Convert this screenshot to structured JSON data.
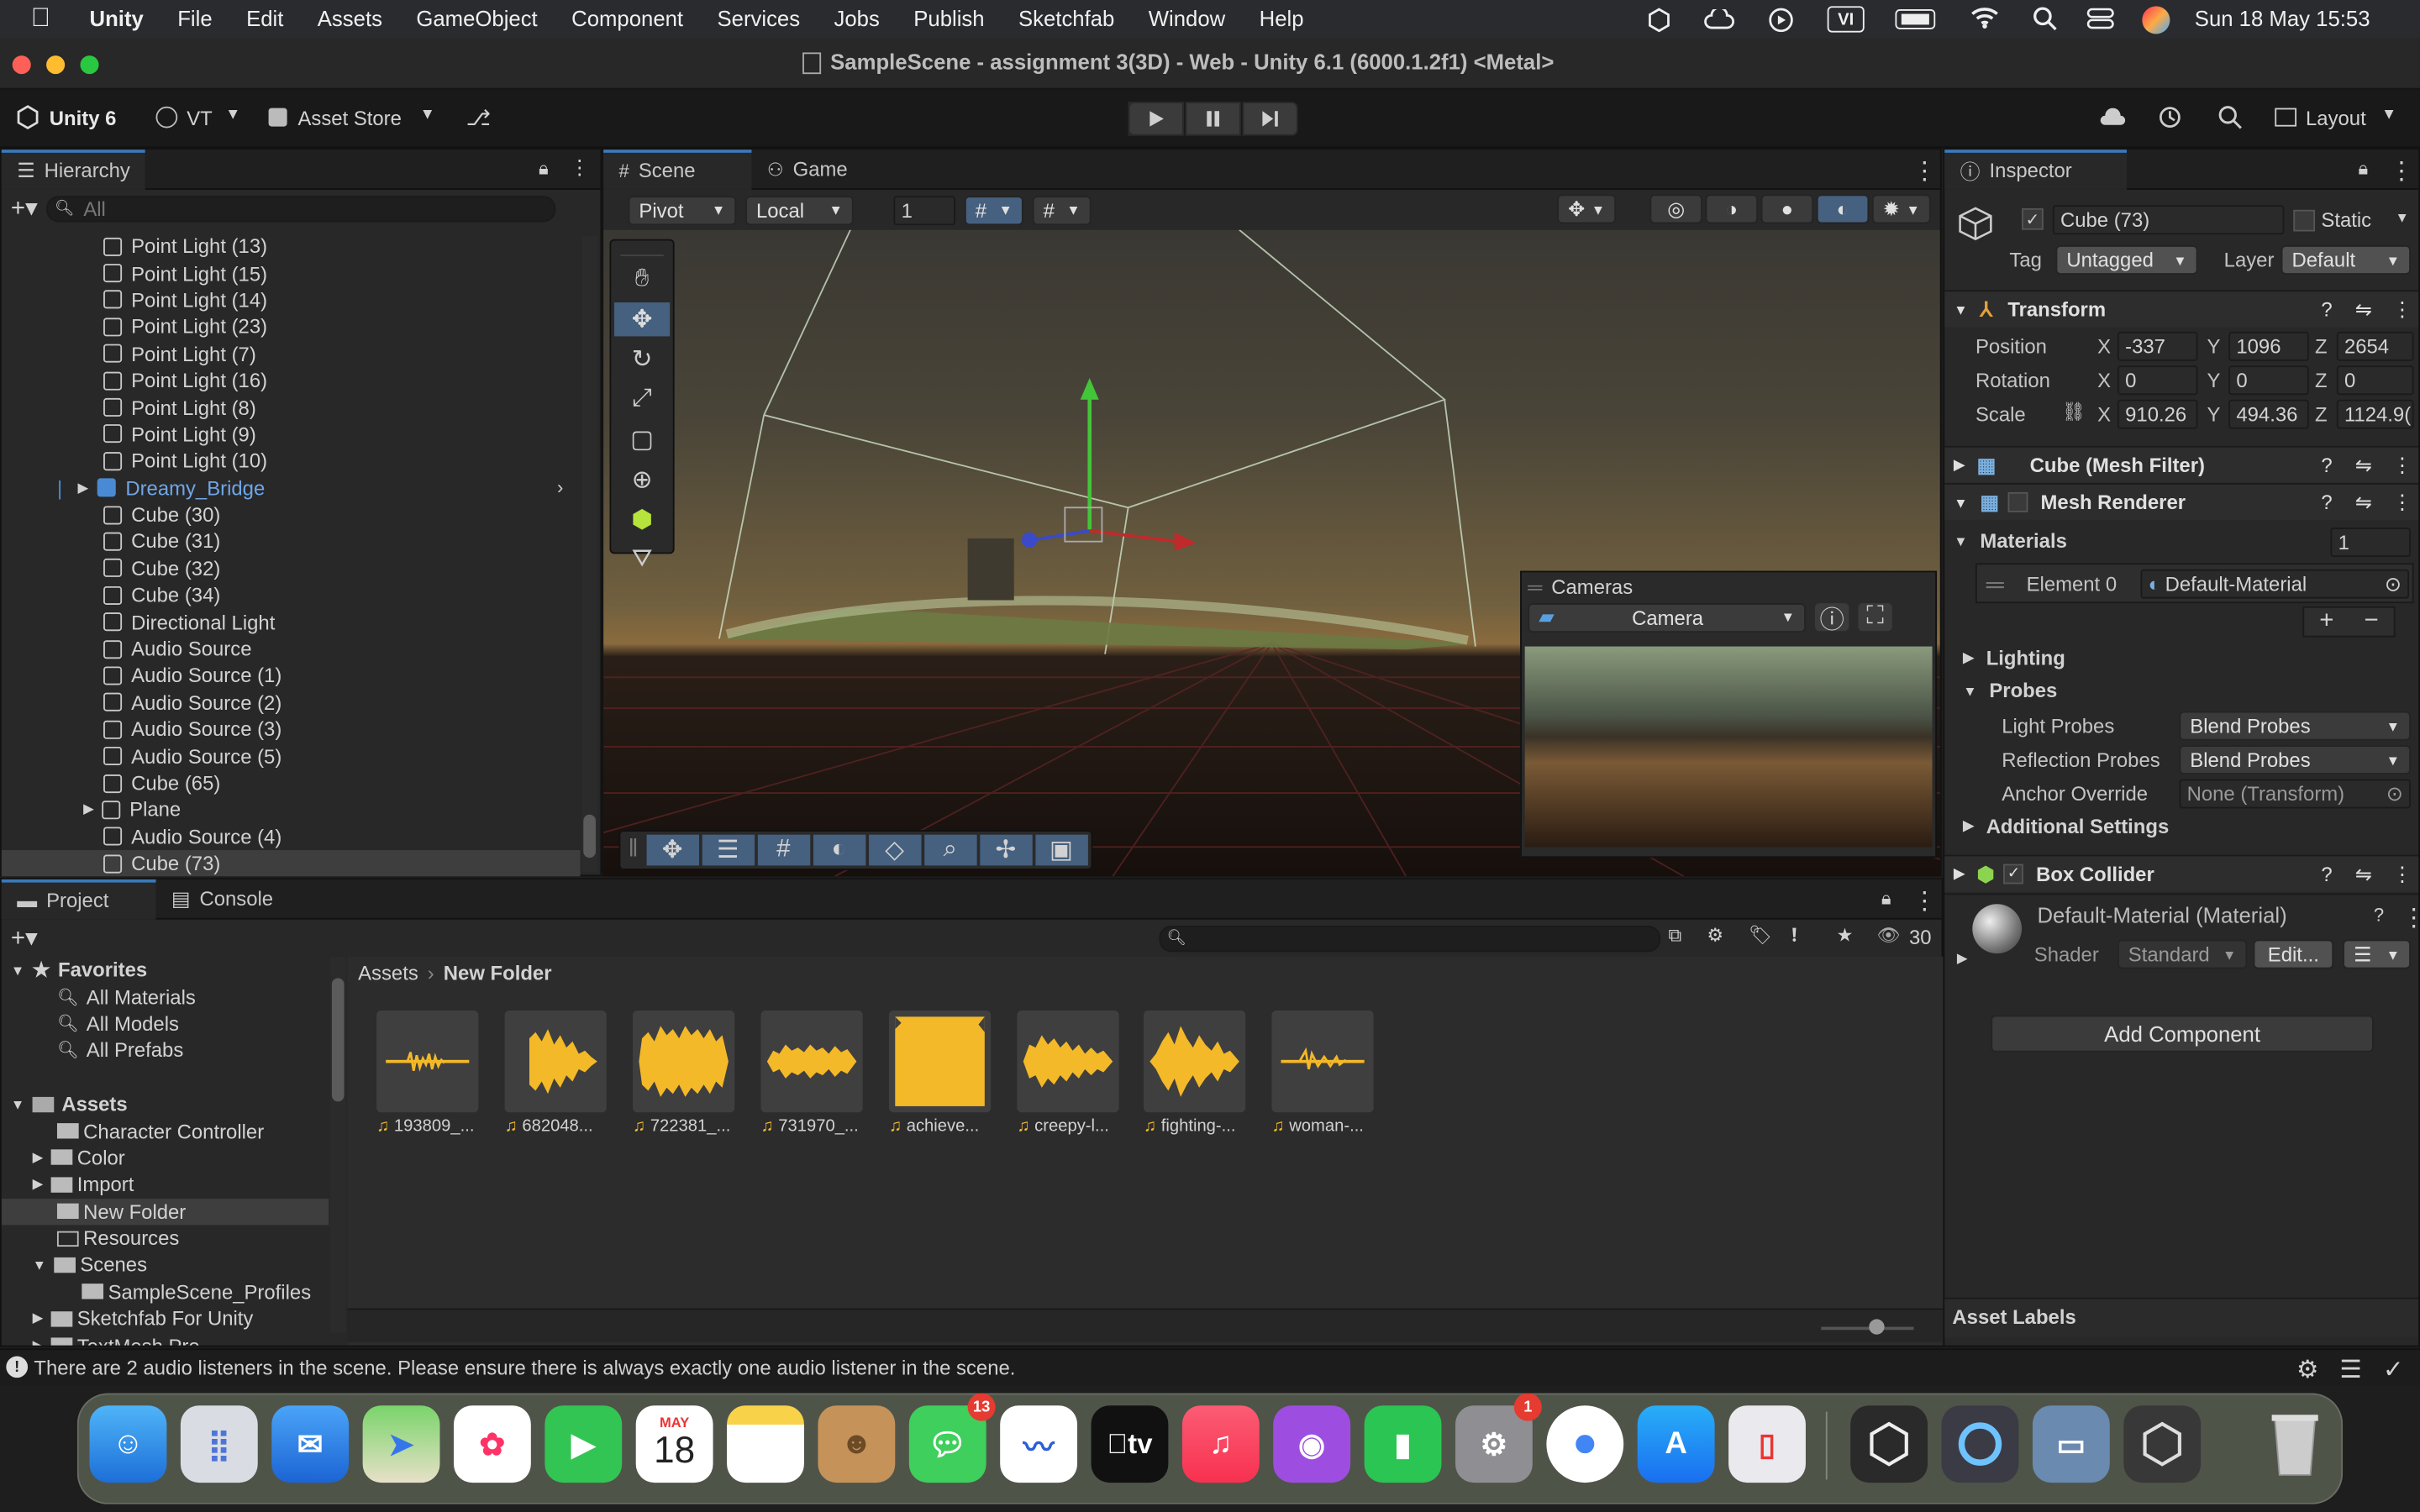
{
  "menubar": {
    "app": "Unity",
    "items": [
      "File",
      "Edit",
      "Assets",
      "GameObject",
      "Component",
      "Services",
      "Jobs",
      "Publish",
      "Sketchfab",
      "Window",
      "Help"
    ],
    "clock": "Sun 18 May  15:53",
    "vi_label": "VI"
  },
  "titlebar": {
    "title": "SampleScene - assignment 3(3D) - Web - Unity 6.1 (6000.1.2f1) <Metal>"
  },
  "toolbar": {
    "unity_label": "Unity 6",
    "account": "VT",
    "asset_store": "Asset Store",
    "layout": "Layout"
  },
  "hierarchy": {
    "tab": "Hierarchy",
    "search_placeholder": "All",
    "items": [
      "Point Light (13)",
      "Point Light (15)",
      "Point Light (14)",
      "Point Light (23)",
      "Point Light (7)",
      "Point Light (16)",
      "Point Light (8)",
      "Point Light (9)",
      "Point Light (10)",
      "Dreamy_Bridge",
      "Cube (30)",
      "Cube (31)",
      "Cube (32)",
      "Cube (34)",
      "Directional Light",
      "Audio Source",
      "Audio Source (1)",
      "Audio Source (2)",
      "Audio Source (3)",
      "Audio Source (5)",
      "Cube (65)",
      "Plane",
      "Audio Source (4)",
      "Cube (73)"
    ]
  },
  "scene": {
    "tabs": [
      "Scene",
      "Game"
    ],
    "pivot": "Pivot",
    "local": "Local",
    "grid_value": "1",
    "cameras_title": "Cameras",
    "camera_select": "Camera"
  },
  "inspector": {
    "tab": "Inspector",
    "object_name": "Cube (73)",
    "static_label": "Static",
    "tag_label": "Tag",
    "tag_value": "Untagged",
    "layer_label": "Layer",
    "layer_value": "Default",
    "transform": "Transform",
    "position_label": "Position",
    "rotation_label": "Rotation",
    "scale_label": "Scale",
    "position": {
      "x": "-337",
      "y": "1096",
      "z": "2654"
    },
    "rotation": {
      "x": "0",
      "y": "0",
      "z": "0"
    },
    "scale": {
      "x": "910.26",
      "y": "494.36",
      "z": "1124.9("
    },
    "axis_x": "X",
    "axis_y": "Y",
    "axis_z": "Z",
    "mesh_filter": "Cube (Mesh Filter)",
    "mesh_renderer": "Mesh Renderer",
    "materials": "Materials",
    "materials_count": "1",
    "element0_label": "Element 0",
    "element0_value": "Default-Material",
    "lighting": "Lighting",
    "probes": "Probes",
    "light_probes_label": "Light Probes",
    "light_probes_value": "Blend Probes",
    "reflection_probes_label": "Reflection Probes",
    "reflection_probes_value": "Blend Probes",
    "anchor_label": "Anchor Override",
    "anchor_value": "None (Transform)",
    "additional_settings": "Additional Settings",
    "box_collider": "Box Collider",
    "material_name": "Default-Material (Material)",
    "shader_label": "Shader",
    "shader_value": "Standard",
    "edit_button": "Edit...",
    "add_component": "Add Component",
    "asset_labels": "Asset Labels"
  },
  "project": {
    "tabs": [
      "Project",
      "Console"
    ],
    "count": "30",
    "favorites_label": "Favorites",
    "favorites": [
      "All Materials",
      "All Models",
      "All Prefabs"
    ],
    "assets_label": "Assets",
    "folders": [
      "Character Controller",
      "Color",
      "Import",
      "New Folder",
      "Resources",
      "Scenes",
      "SampleScene_Profiles",
      "Sketchfab For Unity",
      "TextMesh Pro"
    ],
    "breadcrumb": [
      "Assets",
      "New Folder"
    ],
    "assets": [
      "193809_...",
      "682048...",
      "722381_...",
      "731970_...",
      "achieve...",
      "creepy-l...",
      "fighting-...",
      "woman-..."
    ]
  },
  "status": {
    "message": "There are 2 audio listeners in the scene. Please ensure there is always exactly one audio listener in the scene."
  },
  "dock": {
    "calendar_month": "MAY",
    "calendar_day": "18",
    "messages_badge": "13",
    "settings_badge": "1",
    "tv_label": "tv"
  }
}
